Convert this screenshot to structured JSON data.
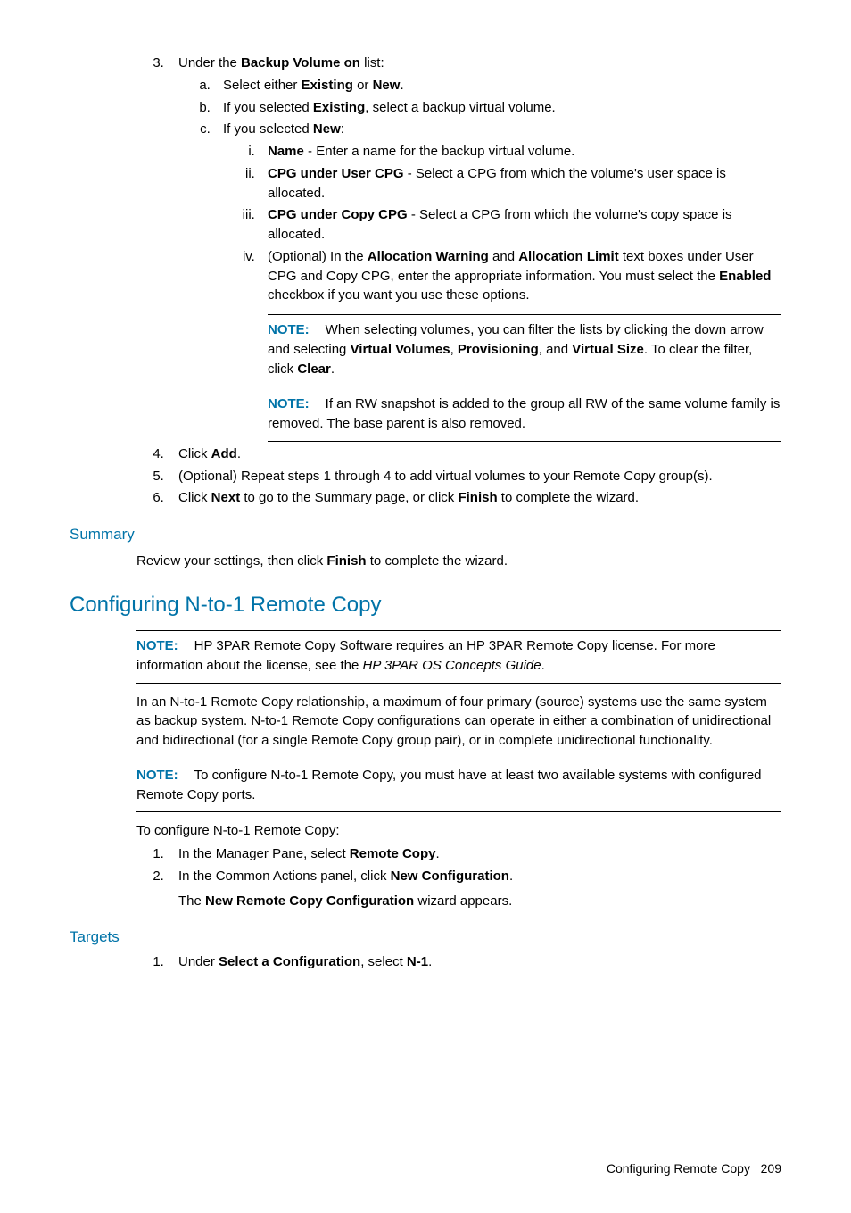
{
  "step3": {
    "pre": "Under the ",
    "bold": "Backup Volume on",
    "post": " list:",
    "a_pre": "Select either ",
    "a_b1": "Existing",
    "a_mid": " or ",
    "a_b2": "New",
    "a_post": ".",
    "b_pre": "If you selected ",
    "b_b": "Existing",
    "b_post": ", select a backup virtual volume.",
    "c_pre": "If you selected ",
    "c_b": "New",
    "c_post": ":",
    "i_b": "Name",
    "i_post": " - Enter a name for the backup virtual volume.",
    "ii_b": "CPG under User CPG",
    "ii_post": " - Select a CPG from which the volume's user space is allocated.",
    "iii_b": "CPG under Copy CPG",
    "iii_post": " - Select a CPG from which the volume's copy space is allocated.",
    "iv_pre": "(Optional) In the ",
    "iv_b1": "Allocation Warning",
    "iv_mid1": " and ",
    "iv_b2": "Allocation Limit",
    "iv_mid2": " text boxes under User CPG and Copy CPG, enter the appropriate information. You must select the ",
    "iv_b3": "Enabled",
    "iv_post": " checkbox if you want you use these options."
  },
  "note1": {
    "label": "NOTE:",
    "pre": "When selecting volumes, you can filter the lists by clicking the down arrow and selecting ",
    "b1": "Virtual Volumes",
    "mid1": ", ",
    "b2": "Provisioning",
    "mid2": ", and ",
    "b3": "Virtual Size",
    "mid3": ". To clear the filter, click ",
    "b4": "Clear",
    "post": "."
  },
  "note2": {
    "label": "NOTE:",
    "text": "If an RW snapshot is added to the group all RW of the same volume family is removed. The base parent is also removed."
  },
  "step4": {
    "pre": "Click ",
    "b": "Add",
    "post": "."
  },
  "step5": "(Optional) Repeat steps 1 through 4 to add virtual volumes to your Remote Copy group(s).",
  "step6": {
    "pre": "Click ",
    "b1": "Next",
    "mid": " to go to the Summary page, or click ",
    "b2": "Finish",
    "post": " to complete the wizard."
  },
  "summary": {
    "heading": "Summary",
    "pre": "Review your settings, then click ",
    "b": "Finish",
    "post": " to complete the wizard."
  },
  "nto1": {
    "heading": "Configuring N-to-1 Remote Copy",
    "note1_label": "NOTE:",
    "note1_pre": "HP 3PAR Remote Copy Software requires an HP 3PAR Remote Copy license. For more information about the license, see the ",
    "note1_it": "HP 3PAR OS Concepts Guide",
    "note1_post": ".",
    "para": "In an N-to-1 Remote Copy relationship, a maximum of four primary (source) systems use the same system as backup system. N-to-1 Remote Copy configurations can operate in either a combination of unidirectional and bidirectional (for a single Remote Copy group pair), or in complete unidirectional functionality.",
    "note2_label": "NOTE:",
    "note2_text": "To configure N-to-1 Remote Copy, you must have at least two available systems with configured Remote Copy ports.",
    "intro": "To configure N-to-1 Remote Copy:",
    "s1_pre": "In the Manager Pane, select ",
    "s1_b": "Remote Copy",
    "s1_post": ".",
    "s2_pre": "In the Common Actions panel, click ",
    "s2_b": "New Configuration",
    "s2_post": ".",
    "s2_line2_pre": "The ",
    "s2_line2_b": "New Remote Copy Configuration",
    "s2_line2_post": " wizard appears."
  },
  "targets": {
    "heading": "Targets",
    "s1_pre": "Under ",
    "s1_b1": "Select a Configuration",
    "s1_mid": ", select ",
    "s1_b2": "N-1",
    "s1_post": "."
  },
  "footer": {
    "text": "Configuring Remote Copy",
    "page": "209"
  }
}
